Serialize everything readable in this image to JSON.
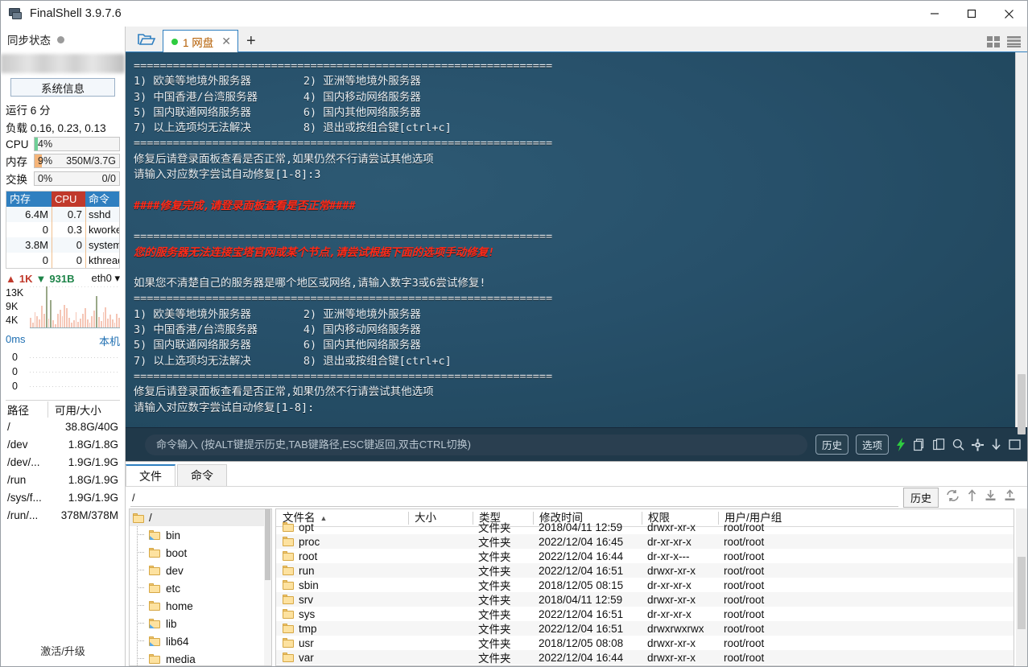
{
  "window": {
    "title": "FinalShell 3.9.7.6",
    "icon": "monitor-icon",
    "minimize": "minimize-icon",
    "maximize": "maximize-icon",
    "close": "close-icon"
  },
  "sidebar": {
    "sync_label": "同步状态",
    "sysinfo_button": "系统信息",
    "uptime": "运行 6 分",
    "load": "负载 0.16, 0.23, 0.13",
    "meters": [
      {
        "label": "CPU",
        "percent": "4%",
        "right": "",
        "fill_pct": 4,
        "color": "#6fcf97"
      },
      {
        "label": "内存",
        "percent": "9%",
        "right": "350M/3.7G",
        "fill_pct": 9,
        "color": "#f5b57a"
      },
      {
        "label": "交换",
        "percent": "0%",
        "right": "0/0",
        "fill_pct": 0,
        "color": "#cccccc"
      }
    ],
    "proc_headers": [
      "内存",
      "CPU",
      "命令"
    ],
    "proc_rows": [
      {
        "mem": "6.4M",
        "cpu": "0.7",
        "cmd": "sshd"
      },
      {
        "mem": "0",
        "cpu": "0.3",
        "cmd": "kworker"
      },
      {
        "mem": "3.8M",
        "cpu": "0",
        "cmd": "systemd"
      },
      {
        "mem": "0",
        "cpu": "0",
        "cmd": "kthreadd"
      }
    ],
    "net": {
      "up": "1K",
      "down": "931B",
      "interface": "eth0",
      "y_labels": [
        "13K",
        "9K",
        "4K"
      ],
      "bars": [
        22,
        10,
        34,
        26,
        18,
        48,
        30,
        92,
        20,
        62,
        16,
        8,
        30,
        40,
        26,
        50,
        44,
        22,
        10,
        16,
        34,
        12,
        20,
        30,
        44,
        18,
        10,
        26,
        38,
        70,
        24,
        14,
        34,
        46,
        20,
        28,
        18,
        10,
        30,
        22
      ],
      "green_index": [
        7,
        9,
        29
      ]
    },
    "latency": {
      "value": "0ms",
      "host": "本机",
      "y_labels": [
        "0",
        "0",
        "0"
      ]
    },
    "disk_headers": [
      "路径",
      "可用/大小"
    ],
    "disk_rows": [
      {
        "path": "/",
        "size": "38.8G/40G"
      },
      {
        "path": "/dev",
        "size": "1.8G/1.8G"
      },
      {
        "path": "/dev/...",
        "size": "1.9G/1.9G"
      },
      {
        "path": "/run",
        "size": "1.8G/1.9G"
      },
      {
        "path": "/sys/f...",
        "size": "1.9G/1.9G"
      },
      {
        "path": "/run/...",
        "size": "378M/378M"
      }
    ],
    "activate": "激活/升级"
  },
  "tabbar": {
    "folder_icon": "open-folder-icon",
    "tabs": [
      {
        "label": "1 网盘",
        "status": "connected"
      }
    ],
    "add": "+",
    "grid_icon": "grid-layout-icon",
    "list_icon": "list-layout-icon"
  },
  "terminal": {
    "lines": [
      {
        "t": "================================================================",
        "c": "white"
      },
      {
        "t": "1) 欧美等地境外服务器        2) 亚洲等地境外服务器",
        "c": "white"
      },
      {
        "t": "3) 中国香港/台湾服务器       4) 国内移动网络服务器",
        "c": "white"
      },
      {
        "t": "5) 国内联通网络服务器        6) 国内其他网络服务器",
        "c": "white"
      },
      {
        "t": "7) 以上选项均无法解决        8) 退出或按组合键[ctrl+c]",
        "c": "white"
      },
      {
        "t": "================================================================",
        "c": "white"
      },
      {
        "t": "修复后请登录面板查看是否正常,如果仍然不行请尝试其他选项",
        "c": "white"
      },
      {
        "t": "请输入对应数字尝试自动修复[1-8]:3",
        "c": "white"
      },
      {
        "t": "",
        "c": "white"
      },
      {
        "t": "####修复完成,请登录面板查看是否正常####",
        "c": "red"
      },
      {
        "t": "",
        "c": "white"
      },
      {
        "t": "================================================================",
        "c": "white"
      },
      {
        "t": "您的服务器无法连接宝塔官网或某个节点,请尝试根据下面的选项手动修复!",
        "c": "red"
      },
      {
        "t": "",
        "c": "white"
      },
      {
        "t": "如果您不清楚自己的服务器是哪个地区或网络,请输入数字3或6尝试修复!",
        "c": "white"
      },
      {
        "t": "================================================================",
        "c": "white"
      },
      {
        "t": "1) 欧美等地境外服务器        2) 亚洲等地境外服务器",
        "c": "white"
      },
      {
        "t": "3) 中国香港/台湾服务器       4) 国内移动网络服务器",
        "c": "white"
      },
      {
        "t": "5) 国内联通网络服务器        6) 国内其他网络服务器",
        "c": "white"
      },
      {
        "t": "7) 以上选项均无法解决        8) 退出或按组合键[ctrl+c]",
        "c": "white"
      },
      {
        "t": "================================================================",
        "c": "white"
      },
      {
        "t": "修复后请登录面板查看是否正常,如果仍然不行请尝试其他选项",
        "c": "white"
      },
      {
        "t": "请输入对应数字尝试自动修复[1-8]:",
        "c": "white"
      }
    ]
  },
  "command_bar": {
    "placeholder": "命令输入 (按ALT键提示历史,TAB键路径,ESC键返回,双击CTRL切换)",
    "value": "",
    "history_button": "历史",
    "options_button": "选项",
    "icons": [
      "bolt-icon",
      "copy-icon",
      "paste-icon",
      "search-icon",
      "gear-icon",
      "download-icon",
      "window-icon"
    ]
  },
  "file_panel": {
    "tabs": [
      {
        "label": "文件",
        "active": true
      },
      {
        "label": "命令",
        "active": false
      }
    ],
    "path_value": "/",
    "history_button": "历史",
    "tools": [
      "refresh-icon",
      "up-level-icon",
      "download-icon",
      "upload-icon"
    ],
    "tree_root": "/",
    "tree_items": [
      {
        "label": "bin",
        "link": true
      },
      {
        "label": "boot",
        "link": false
      },
      {
        "label": "dev",
        "link": false
      },
      {
        "label": "etc",
        "link": false
      },
      {
        "label": "home",
        "link": false
      },
      {
        "label": "lib",
        "link": true
      },
      {
        "label": "lib64",
        "link": true
      },
      {
        "label": "media",
        "link": false
      }
    ],
    "columns": [
      "文件名",
      "大小",
      "类型",
      "修改时间",
      "权限",
      "用户/用户组"
    ],
    "sort_column": "文件名",
    "sort_dir": "asc",
    "rows": [
      {
        "name": "opt",
        "size": "",
        "type": "文件夹",
        "time": "2018/04/11 12:59",
        "perm": "drwxr-xr-x",
        "owner": "root/root"
      },
      {
        "name": "proc",
        "size": "",
        "type": "文件夹",
        "time": "2022/12/04 16:45",
        "perm": "dr-xr-xr-x",
        "owner": "root/root"
      },
      {
        "name": "root",
        "size": "",
        "type": "文件夹",
        "time": "2022/12/04 16:44",
        "perm": "dr-xr-x---",
        "owner": "root/root"
      },
      {
        "name": "run",
        "size": "",
        "type": "文件夹",
        "time": "2022/12/04 16:51",
        "perm": "drwxr-xr-x",
        "owner": "root/root"
      },
      {
        "name": "sbin",
        "size": "",
        "type": "文件夹",
        "time": "2018/12/05 08:15",
        "perm": "dr-xr-xr-x",
        "owner": "root/root"
      },
      {
        "name": "srv",
        "size": "",
        "type": "文件夹",
        "time": "2018/04/11 12:59",
        "perm": "drwxr-xr-x",
        "owner": "root/root"
      },
      {
        "name": "sys",
        "size": "",
        "type": "文件夹",
        "time": "2022/12/04 16:51",
        "perm": "dr-xr-xr-x",
        "owner": "root/root"
      },
      {
        "name": "tmp",
        "size": "",
        "type": "文件夹",
        "time": "2022/12/04 16:51",
        "perm": "drwxrwxrwx",
        "owner": "root/root"
      },
      {
        "name": "usr",
        "size": "",
        "type": "文件夹",
        "time": "2018/12/05 08:08",
        "perm": "drwxr-xr-x",
        "owner": "root/root"
      },
      {
        "name": "var",
        "size": "",
        "type": "文件夹",
        "time": "2022/12/04 16:44",
        "perm": "drwxr-xr-x",
        "owner": "root/root"
      }
    ]
  }
}
